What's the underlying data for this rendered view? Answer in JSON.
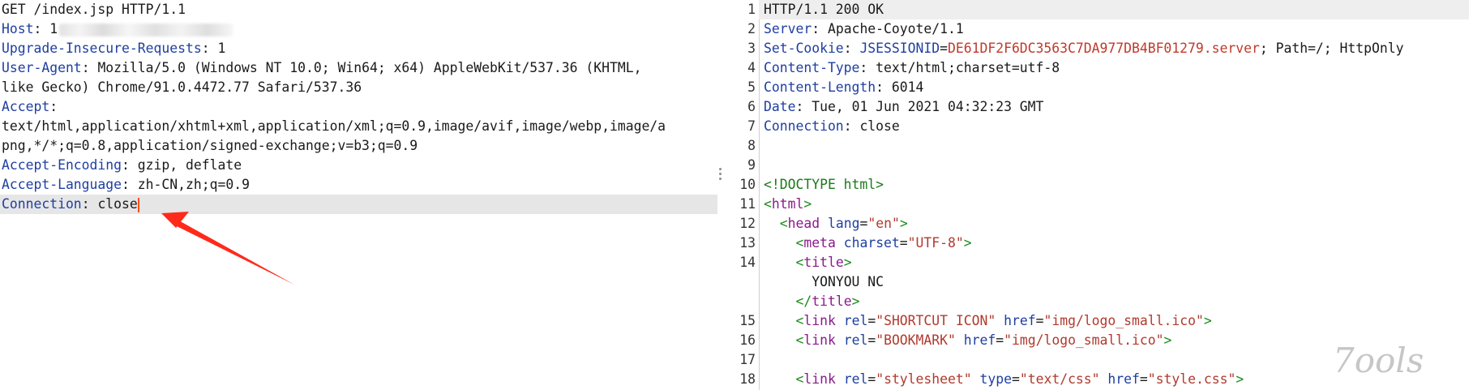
{
  "request": {
    "request_line": "GET /index.jsp HTTP/1.1",
    "headers": [
      {
        "key": "Host",
        "sep": ": ",
        "value": "1"
      },
      {
        "key": "Upgrade-Insecure-Requests",
        "sep": ": ",
        "value": "1"
      },
      {
        "key": "User-Agent",
        "sep": ": ",
        "value": "Mozilla/5.0 (Windows NT 10.0; Win64; x64) AppleWebKit/537.36 (KHTML,"
      },
      {
        "continuation": "like Gecko) Chrome/91.0.4472.77 Safari/537.36"
      },
      {
        "key": "Accept",
        "sep": ":",
        "value": ""
      },
      {
        "continuation": "text/html,application/xhtml+xml,application/xml;q=0.9,image/avif,image/webp,image/a"
      },
      {
        "continuation": "png,*/*;q=0.8,application/signed-exchange;v=b3;q=0.9"
      },
      {
        "key": "Accept-Encoding",
        "sep": ": ",
        "value": "gzip, deflate"
      },
      {
        "key": "Accept-Language",
        "sep": ": ",
        "value": "zh-CN,zh;q=0.9"
      },
      {
        "key": "Connection",
        "sep": ": ",
        "value": "close"
      }
    ]
  },
  "response": {
    "lines": [
      {
        "n": "1",
        "text": "HTTP/1.1 200 OK"
      },
      {
        "n": "2",
        "key": "Server",
        "value": "Apache-Coyote/1.1"
      },
      {
        "n": "3",
        "key": "Set-Cookie",
        "cookie_name": "JSESSIONID",
        "cookie_value": "DE61DF2F6DC3563C7DA977DB4BF01279.server",
        "rest": "; Path=/; HttpOnly"
      },
      {
        "n": "4",
        "key": "Content-Type",
        "value": "text/html;charset=utf-8"
      },
      {
        "n": "5",
        "key": "Content-Length",
        "value": "6014"
      },
      {
        "n": "6",
        "key": "Date",
        "value": "Tue, 01 Jun 2021 04:32:23 GMT"
      },
      {
        "n": "7",
        "key": "Connection",
        "value": "close"
      },
      {
        "n": "8"
      },
      {
        "n": "9"
      },
      {
        "n": "10",
        "doctype": "<!DOCTYPE html>"
      },
      {
        "n": "11",
        "open": "html"
      },
      {
        "n": "12",
        "indent": "  ",
        "open": "head",
        "attrs": [
          {
            "a": "lang",
            "v": "\"en\""
          }
        ]
      },
      {
        "n": "13",
        "indent": "    ",
        "open": "meta",
        "attrs": [
          {
            "a": "charset",
            "v": "\"UTF-8\""
          }
        ]
      },
      {
        "n": "14",
        "indent": "    ",
        "open": "title"
      },
      {
        "n": "",
        "indent": "      ",
        "text": "YONYOU NC"
      },
      {
        "n": "",
        "indent": "    ",
        "close": "title"
      },
      {
        "n": "15",
        "indent": "    ",
        "open": "link",
        "attrs": [
          {
            "a": "rel",
            "v": "\"SHORTCUT ICON\""
          },
          {
            "a": "href",
            "v": "\"img/logo_small.ico\""
          }
        ]
      },
      {
        "n": "16",
        "indent": "    ",
        "open": "link",
        "attrs": [
          {
            "a": "rel",
            "v": "\"BOOKMARK\""
          },
          {
            "a": "href",
            "v": "\"img/logo_small.ico\""
          }
        ]
      },
      {
        "n": "17"
      },
      {
        "n": "18",
        "indent": "    ",
        "open": "link",
        "attrs": [
          {
            "a": "rel",
            "v": "\"stylesheet\""
          },
          {
            "a": "type",
            "v": "\"text/css\""
          },
          {
            "a": "href",
            "v": "\"style.css\""
          }
        ]
      }
    ]
  },
  "watermark_text": "7ools",
  "colors": {
    "header_key": "#1f3fa0",
    "cookie_value": "#c0392b",
    "arrow": "#ff2a1a",
    "cursor": "#ff4d1a"
  }
}
